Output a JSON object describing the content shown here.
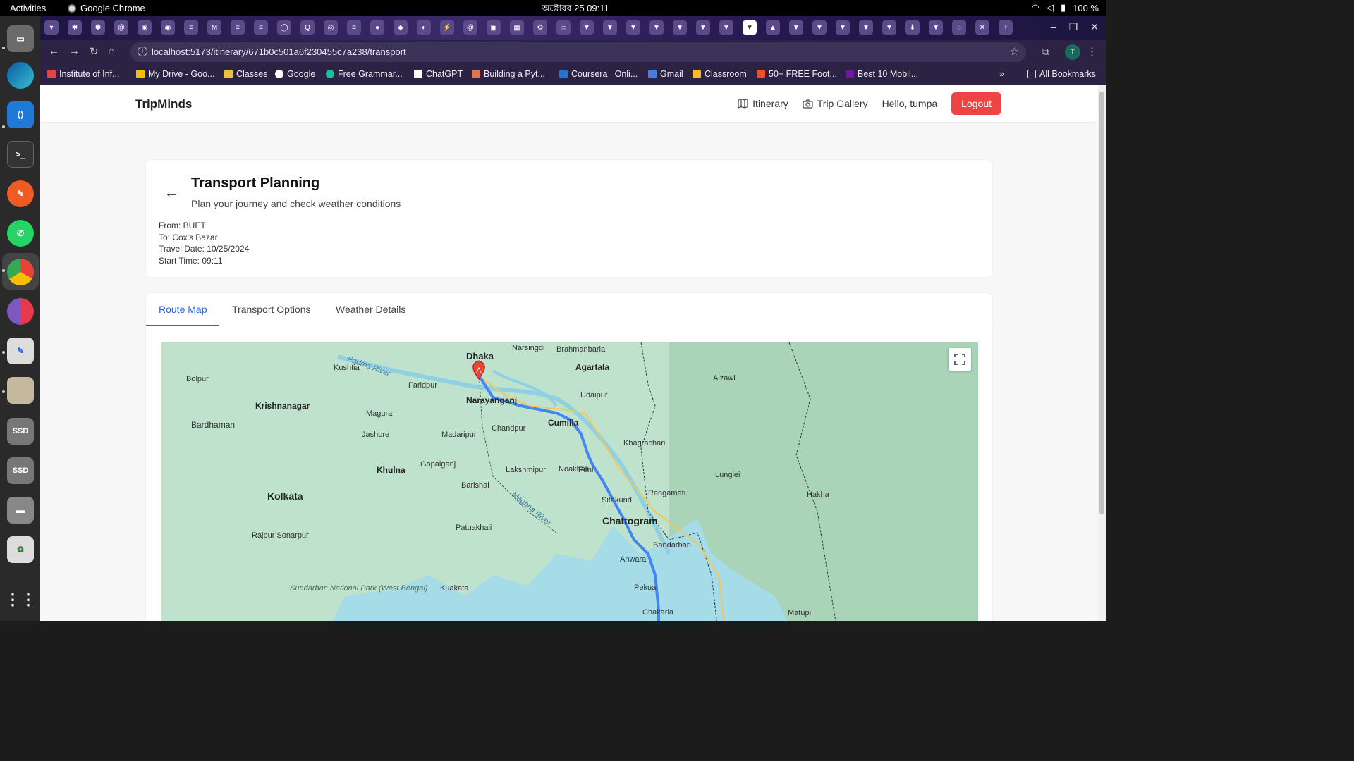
{
  "os": {
    "activities": "Activities",
    "app_name": "Google Chrome",
    "clock": "অক্টোবর 25  09:11",
    "battery": "100 %"
  },
  "browser": {
    "url": "localhost:5173/itinerary/671b0c501a6f230455c7a238/transport",
    "bookmarks": [
      "Institute of Inf...",
      "My Drive - Goo...",
      "Classes",
      "Google",
      "Free Grammar...",
      "ChatGPT",
      "Building a Pyt...",
      "Coursera | Onli...",
      "Gmail",
      "Classroom",
      "50+ FREE Foot...",
      "Best 10 Mobil..."
    ],
    "all_bookmarks": "All Bookmarks",
    "profile_initial": "T"
  },
  "app": {
    "brand": "TripMinds",
    "nav": {
      "itinerary": "Itinerary",
      "gallery": "Trip Gallery",
      "greeting": "Hello, tumpa",
      "logout": "Logout"
    },
    "header": {
      "title": "Transport Planning",
      "subtitle": "Plan your journey and check weather conditions",
      "from": "From: BUET",
      "to": "To: Cox's Bazar",
      "date": "Travel Date: 10/25/2024",
      "time": "Start Time: 09:11"
    },
    "tabs": [
      "Route Map",
      "Transport Options",
      "Weather Details"
    ],
    "map": {
      "marker": "A",
      "labels": {
        "dhaka": "Dhaka",
        "narayanganj": "Narayanganj",
        "cumilla": "Cumilla",
        "agartala": "Agartala",
        "chattogram": "Chattogram",
        "kolkata": "Kolkata",
        "khulna": "Khulna",
        "barishal": "Barishal",
        "krishnanagar": "Krishnanagar",
        "bardhaman": "Bardhaman",
        "jashore": "Jashore",
        "faridpur": "Faridpur",
        "chandpur": "Chandpur",
        "lakshmipur": "Lakshmipur",
        "noakhali": "Noakhali",
        "feni": "Feni",
        "rangamati": "Rangamati",
        "bandarban": "Bandarban",
        "sundarban": "Sundarban National Park (West Bengal)",
        "padma": "Padma River",
        "meghna": "Meghna River",
        "aizawl": "Aizawl",
        "lunglei": "Lunglei",
        "rajpur": "Rajpur Sonarpur",
        "madaripur": "Madaripur",
        "gopalganj": "Gopalganj",
        "patuakhali": "Patuakhali",
        "kuakata": "Kuakata",
        "pekua": "Pekua",
        "khagrachari": "Khagrachari",
        "bolpur": "Bolpur",
        "kushtia": "Kushtia",
        "magura": "Magura",
        "sitakund": "Sitakund",
        "hakha": "Hakha",
        "matupi": "Matupi",
        "anwara": "Anwara",
        "chakaria": "Chakaria",
        "udaipur": "Udaipur",
        "narsingdi": "Narsingdi",
        "brahmanbaria": "Brahmanbaria"
      }
    }
  }
}
